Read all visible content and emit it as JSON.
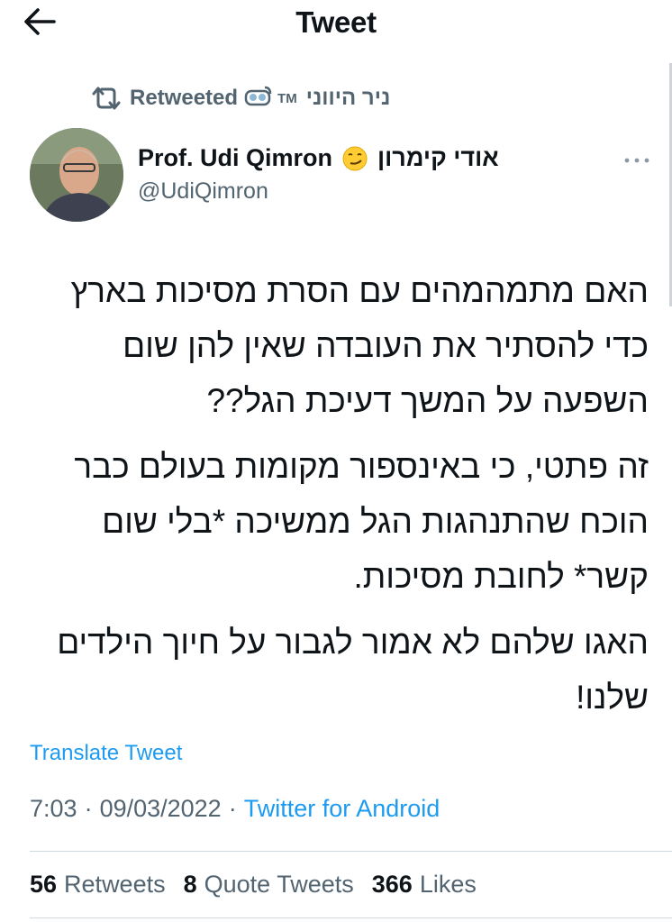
{
  "header": {
    "title": "Tweet"
  },
  "retweet": {
    "label": "Retweeted",
    "retweeter_name": "ניר היווני",
    "retweeter_tm": "TM"
  },
  "author": {
    "display_name_en": "Prof. Udi Qimron",
    "display_name_he": "אודי קימרון",
    "handle": "@UdiQimron"
  },
  "tweet": {
    "paragraphs": [
      "האם מתמהמהים עם הסרת מסיכות בארץ כדי להסתיר את העובדה שאין להן שום השפעה על המשך דעיכת הגל??",
      "זה פתטי, כי באינספור מקומות בעולם כבר הוכח שהתנהגות הגל ממשיכה *בלי שום קשר* לחובת מסיכות.",
      "האגו שלהם לא אמור לגבור על חיוך הילדים שלנו!"
    ],
    "translate_label": "Translate Tweet"
  },
  "meta": {
    "time": "7:03",
    "separator": "·",
    "date": "09/03/2022",
    "source": "Twitter for Android"
  },
  "stats": {
    "retweets_count": "56",
    "retweets_label": "Retweets",
    "quotes_count": "8",
    "quotes_label": "Quote Tweets",
    "likes_count": "366",
    "likes_label": "Likes"
  },
  "colors": {
    "accent": "#1d9bf0",
    "secondary_text": "#536471",
    "primary_text": "#0f1419"
  },
  "icons": {
    "back": "back-arrow-icon",
    "retweet": "retweet-icon",
    "more": "more-dots-icon"
  }
}
